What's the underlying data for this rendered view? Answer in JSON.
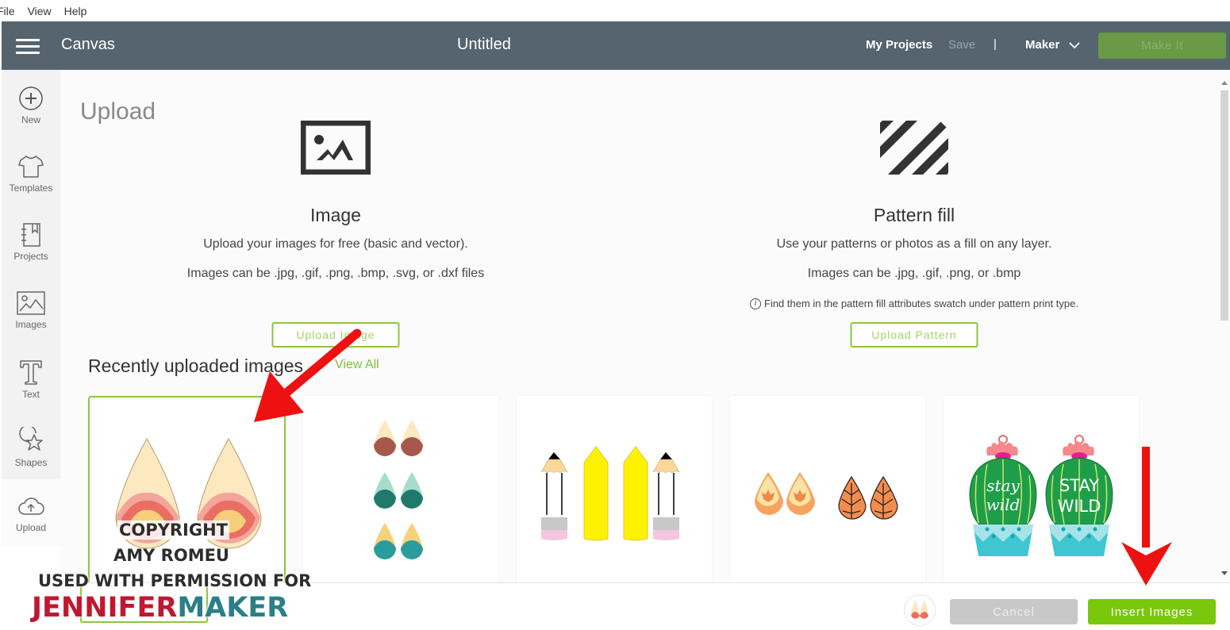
{
  "menubar": {
    "items": [
      "File",
      "View",
      "Help"
    ]
  },
  "topbar": {
    "app_title": "Canvas",
    "document_title": "Untitled",
    "my_projects": "My Projects",
    "save": "Save",
    "separator": "|",
    "machine": "Maker",
    "make_it": "Make It"
  },
  "sidebar": {
    "items": [
      {
        "label": "New",
        "icon": "plus-circle-icon"
      },
      {
        "label": "Templates",
        "icon": "tshirt-icon"
      },
      {
        "label": "Projects",
        "icon": "notebook-icon"
      },
      {
        "label": "Images",
        "icon": "image-icon"
      },
      {
        "label": "Text",
        "icon": "text-t-icon"
      },
      {
        "label": "Shapes",
        "icon": "shapes-icon"
      },
      {
        "label": "Upload",
        "icon": "cloud-upload-icon"
      }
    ],
    "active": "Upload"
  },
  "main": {
    "page_title": "Upload",
    "image_section": {
      "title": "Image",
      "description": "Upload your images for free (basic and vector).",
      "types": "Images can be .jpg, .gif, .png, .bmp, .svg, or .dxf files",
      "button": "Upload Image"
    },
    "pattern_section": {
      "title": "Pattern fill",
      "description": "Use your patterns or photos as a fill on any layer.",
      "types": "Images can be .jpg, .gif, .png, or .bmp",
      "note_icon": "i",
      "note": "Find them in the pattern fill attributes swatch under pattern print type.",
      "button": "Upload Pattern"
    },
    "recent": {
      "title": "Recently uploaded images",
      "view_all": "View All",
      "thumbnails": [
        {
          "name": "mandala-teardrop-earrings",
          "selected": true
        },
        {
          "name": "mandala-teardrop-earring-set",
          "selected": false
        },
        {
          "name": "pencil-earrings",
          "selected": false
        },
        {
          "name": "maple-leaf-teardrop-earrings",
          "selected": false
        },
        {
          "name": "stay-wild-cactus-earrings",
          "selected": false,
          "text_left": "stay wild",
          "text_right": "STAY WILD"
        }
      ]
    }
  },
  "footer": {
    "cancel": "Cancel",
    "insert": "Insert Images"
  },
  "watermark": {
    "line1": "COPYRIGHT",
    "line2": "AMY ROMEU",
    "line3": "USED WITH PERMISSION FOR",
    "brand_part1": "JENNIFER",
    "brand_part2": "MAKER"
  },
  "colors": {
    "topbar": "#56646f",
    "accent_green": "#7ac70c",
    "outline_green": "#8dc63f",
    "make_it_disabled": "#6a9a45",
    "annotation_arrow": "#ee1111",
    "brand_red": "#c0182f",
    "brand_teal": "#2b7f86"
  }
}
